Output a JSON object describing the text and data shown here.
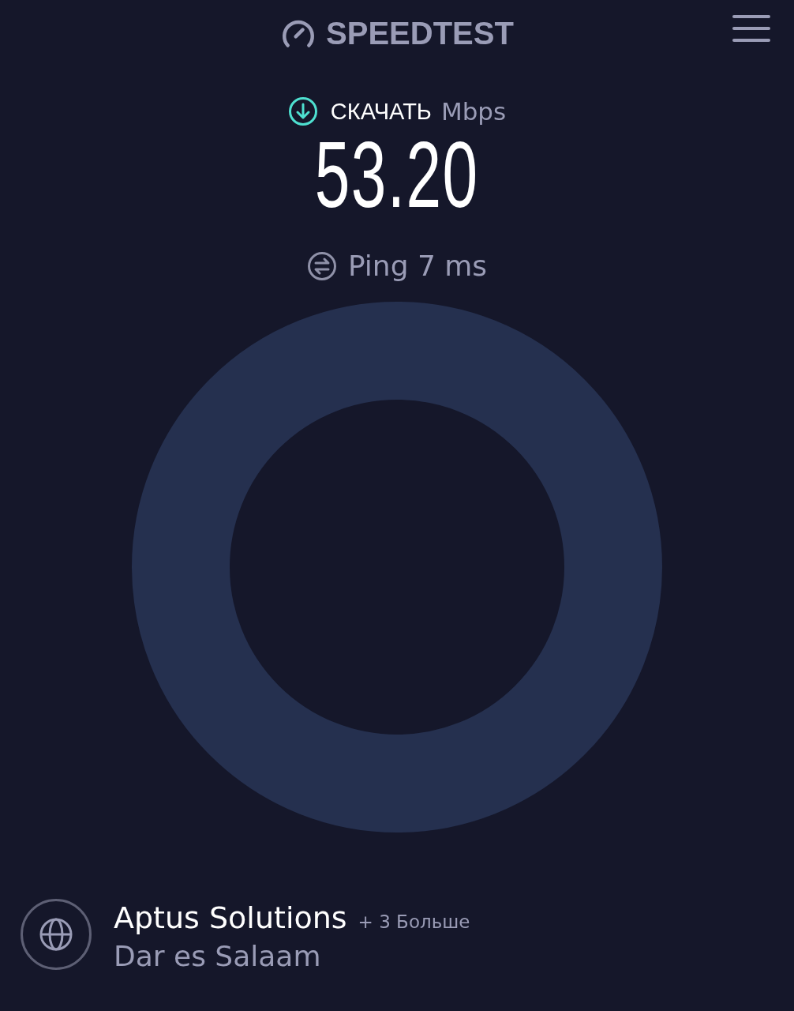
{
  "header": {
    "logo": "SPEEDTEST"
  },
  "result": {
    "label": "СКАЧАТЬ",
    "unit": "Mbps",
    "value": "53.20",
    "ping": "Ping 7 ms"
  },
  "server": {
    "name": "Aptus Solutions",
    "more": "+ 3 Больше",
    "location": "Dar es Salaam"
  }
}
